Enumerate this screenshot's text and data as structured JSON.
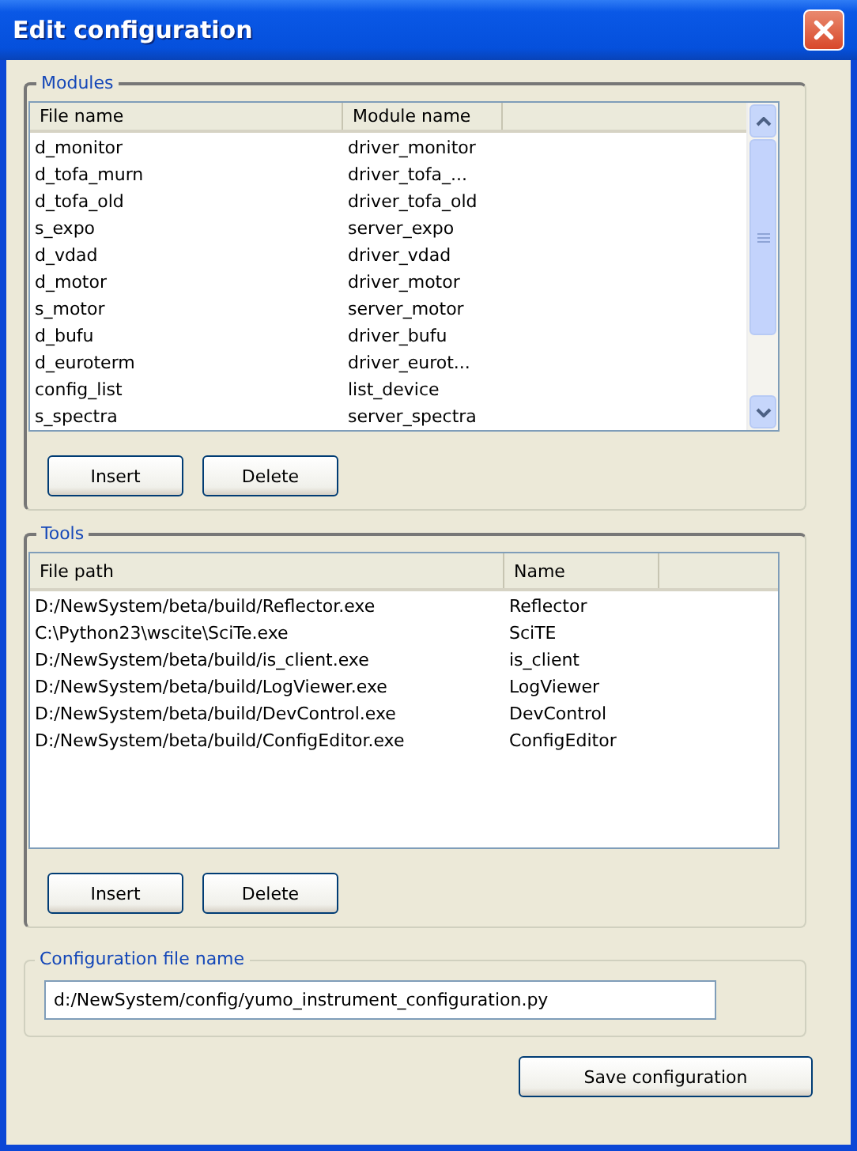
{
  "window": {
    "title": "Edit configuration"
  },
  "modules": {
    "title": "Modules",
    "columns": [
      "File name",
      "Module name"
    ],
    "rows": [
      [
        "d_monitor",
        "driver_monitor"
      ],
      [
        "d_tofa_murn",
        "driver_tofa_..."
      ],
      [
        "d_tofa_old",
        "driver_tofa_old"
      ],
      [
        "s_expo",
        "server_expo"
      ],
      [
        "d_vdad",
        "driver_vdad"
      ],
      [
        "d_motor",
        "driver_motor"
      ],
      [
        "s_motor",
        "server_motor"
      ],
      [
        "d_bufu",
        "driver_bufu"
      ],
      [
        "d_euroterm",
        "driver_eurot..."
      ],
      [
        "config_list",
        "list_device"
      ],
      [
        "s_spectra",
        "server_spectra"
      ]
    ],
    "buttons": [
      "Insert",
      "Delete"
    ]
  },
  "tools": {
    "title": "Tools",
    "columns": [
      "File path",
      "Name"
    ],
    "rows": [
      [
        "D:/NewSystem/beta/build/Reflector.exe",
        "Reflector"
      ],
      [
        "C:\\Python23\\wscite\\SciTe.exe",
        "SciTE"
      ],
      [
        "D:/NewSystem/beta/build/is_client.exe",
        "is_client"
      ],
      [
        "D:/NewSystem/beta/build/LogViewer.exe",
        "LogViewer"
      ],
      [
        "D:/NewSystem/beta/build/DevControl.exe",
        "DevControl"
      ],
      [
        "D:/NewSystem/beta/build/ConfigEditor.exe",
        "ConfigEditor"
      ]
    ],
    "buttons": [
      "Insert",
      "Delete"
    ]
  },
  "config_file": {
    "title": "Configuration file name",
    "value": "d:/NewSystem/config/yumo_instrument_configuration.py"
  },
  "save_button": "Save configuration"
}
